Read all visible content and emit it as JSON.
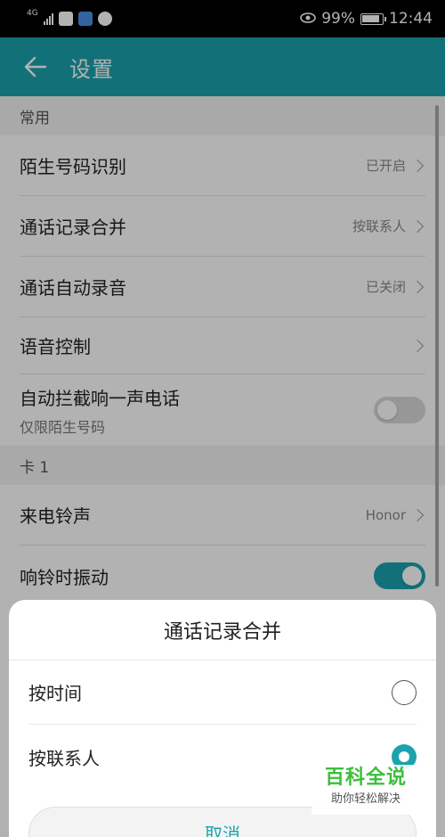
{
  "status_bar": {
    "network": "4G",
    "battery": "99%",
    "time": "12:44"
  },
  "app_bar": {
    "title": "设置"
  },
  "settings": {
    "section_common": "常用",
    "unknown_number": {
      "label": "陌生号码识别",
      "value": "已开启"
    },
    "merge_call_log": {
      "label": "通话记录合并",
      "value": "按联系人"
    },
    "auto_record": {
      "label": "通话自动录音",
      "value": "已关闭"
    },
    "voice_control": {
      "label": "语音控制"
    },
    "block_one_ring": {
      "label": "自动拦截响一声电话",
      "sub": "仅限陌生号码",
      "enabled": false
    },
    "section_card": "卡 1",
    "ringtone": {
      "label": "来电铃声",
      "value": "Honor"
    },
    "vibrate": {
      "label": "响铃时振动",
      "enabled": true
    }
  },
  "dialog": {
    "title": "通话记录合并",
    "options": [
      {
        "label": "按时间",
        "selected": false
      },
      {
        "label": "按联系人",
        "selected": true
      }
    ],
    "cancel": "取消"
  },
  "watermark": {
    "brand": "百科全说",
    "slogan": "助你轻松解决"
  },
  "colors": {
    "accent": "#1aa3ad",
    "section_bg": "#f2f2f2"
  }
}
